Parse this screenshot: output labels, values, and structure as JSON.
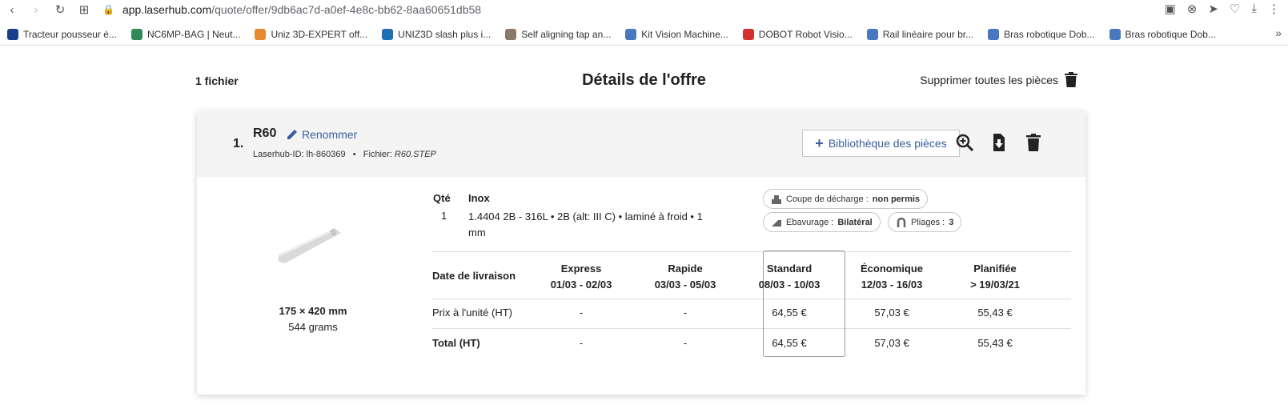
{
  "browser": {
    "url_domain": "app.laserhub.com",
    "url_path": "/quote/offer/9db6ac7d-a0ef-4e8c-bb62-8aa60651db58"
  },
  "bookmarks": [
    {
      "label": "Tracteur pousseur é...",
      "color": "#1c3f8c"
    },
    {
      "label": "NC6MP-BAG | Neut...",
      "color": "#2e8b57"
    },
    {
      "label": "Uniz 3D-EXPERT off...",
      "color": "#e8892e"
    },
    {
      "label": "UNIZ3D slash plus i...",
      "color": "#1f6fb5"
    },
    {
      "label": "Self aligning tap an...",
      "color": "#8a7a6a"
    },
    {
      "label": "Kit Vision Machine...",
      "color": "#4a78c0"
    },
    {
      "label": "DOBOT Robot Visio...",
      "color": "#d32f2f"
    },
    {
      "label": "Rail linéaire pour br...",
      "color": "#4a78c0"
    },
    {
      "label": "Bras robotique Dob...",
      "color": "#4a78c0"
    },
    {
      "label": "Bras robotique Dob...",
      "color": "#4a78c0"
    }
  ],
  "header": {
    "files_count": "1 fichier",
    "title": "Détails de l'offre",
    "delete_all": "Supprimer toutes les pièces"
  },
  "part": {
    "number": "1.",
    "name": "R60",
    "rename": "Renommer",
    "id_label": "Laserhub-ID: lh-860369",
    "separator": "•",
    "file_label": "Fichier:",
    "file_name": "R60.STEP",
    "library_button": "Bibliothèque des pièces",
    "dimensions": "175 × 420 mm",
    "weight": "544 grams",
    "qty_header": "Qté",
    "qty_value": "1",
    "material_header": "Inox",
    "material_desc": "1.4404 2B - 316L • 2B (alt: III C) • laminé à froid • 1 mm"
  },
  "chips": [
    {
      "label": "Coupe de décharge : ",
      "value": "non permis"
    },
    {
      "label": "Ebavurage : ",
      "value": "Bilatéral"
    },
    {
      "label": "Pliages : ",
      "value": "3"
    }
  ],
  "pricing": {
    "delivery_label": "Date de livraison",
    "unit_label": "Prix à l'unité (HT)",
    "total_label": "Total (HT)",
    "columns": [
      {
        "name": "Express",
        "dates": "01/03 - 02/03",
        "unit": "-",
        "total": "-"
      },
      {
        "name": "Rapide",
        "dates": "03/03 - 05/03",
        "unit": "-",
        "total": "-"
      },
      {
        "name": "Standard",
        "dates": "08/03 - 10/03",
        "unit": "64,55 €",
        "total": "64,55 €"
      },
      {
        "name": "Économique",
        "dates": "12/03 - 16/03",
        "unit": "57,03 €",
        "total": "57,03 €"
      },
      {
        "name": "Planifiée",
        "dates": "> 19/03/21",
        "unit": "55,43 €",
        "total": "55,43 €"
      }
    ],
    "selected": "Standard"
  }
}
